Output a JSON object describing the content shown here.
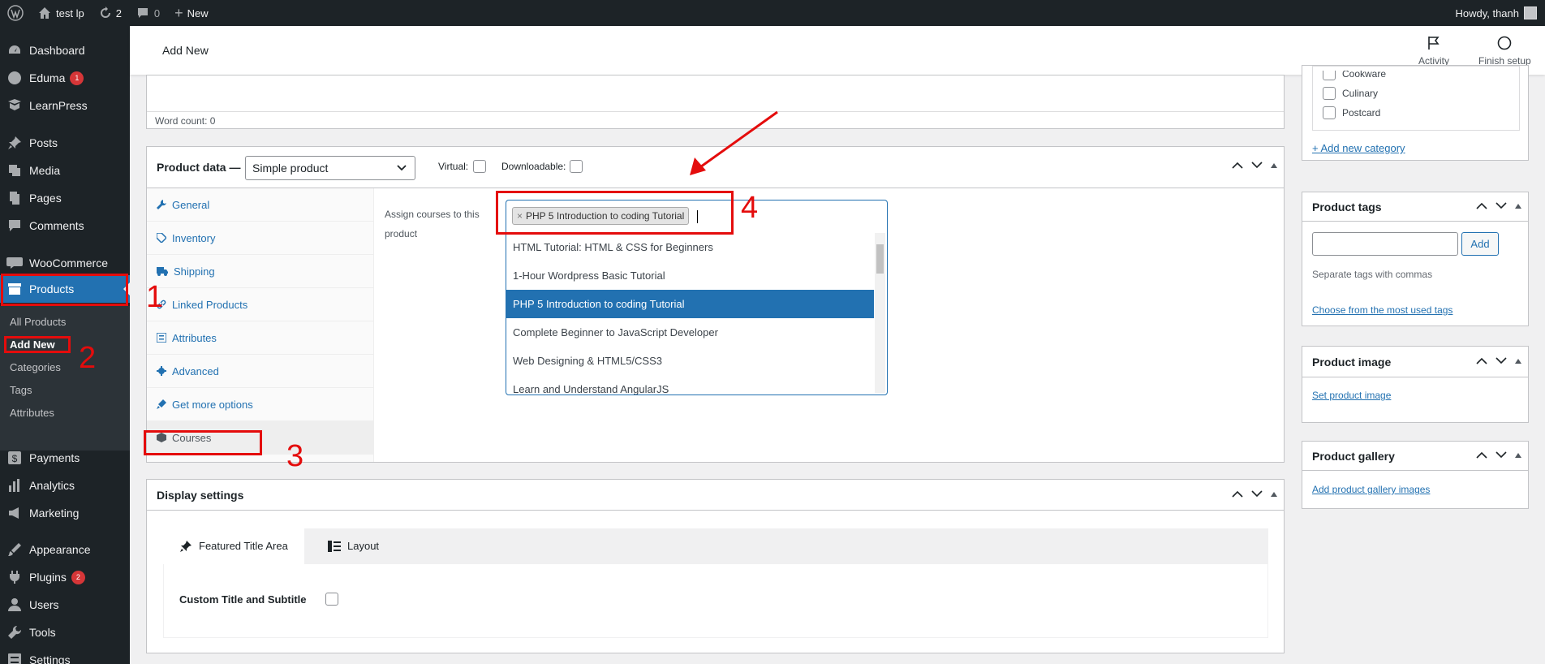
{
  "adminbar": {
    "site_name": "test lp",
    "updates_count": "2",
    "comments_count": "0",
    "new_label": "New",
    "howdy": "Howdy, thanh"
  },
  "sidebar": {
    "items": [
      {
        "label": "Dashboard",
        "icon": "dashboard-icon"
      },
      {
        "label": "Eduma",
        "icon": "eduma-icon",
        "badge": "1"
      },
      {
        "label": "LearnPress",
        "icon": "learnpress-icon"
      },
      {
        "label": "Posts",
        "icon": "pin-icon"
      },
      {
        "label": "Media",
        "icon": "media-icon"
      },
      {
        "label": "Pages",
        "icon": "pages-icon"
      },
      {
        "label": "Comments",
        "icon": "comments-icon"
      },
      {
        "label": "WooCommerce",
        "icon": "woocommerce-icon"
      },
      {
        "label": "Products",
        "icon": "archive-icon"
      },
      {
        "label": "Payments",
        "icon": "dollar-icon"
      },
      {
        "label": "Analytics",
        "icon": "bar-chart-icon"
      },
      {
        "label": "Marketing",
        "icon": "megaphone-icon"
      },
      {
        "label": "Appearance",
        "icon": "brush-icon"
      },
      {
        "label": "Plugins",
        "icon": "plug-icon",
        "badge": "2"
      },
      {
        "label": "Users",
        "icon": "user-icon"
      },
      {
        "label": "Tools",
        "icon": "wrench-icon"
      },
      {
        "label": "Settings",
        "icon": "settings-icon"
      }
    ],
    "submenu": [
      "All Products",
      "Add New",
      "Categories",
      "Tags",
      "Attributes"
    ]
  },
  "header": {
    "title": "Add New",
    "activity": "Activity",
    "finish_setup": "Finish setup"
  },
  "editor": {
    "word_count": "Word count: 0"
  },
  "product_data": {
    "title": "Product data —",
    "type_selected": "Simple product",
    "virtual_label": "Virtual:",
    "downloadable_label": "Downloadable:",
    "tabs": [
      "General",
      "Inventory",
      "Shipping",
      "Linked Products",
      "Attributes",
      "Advanced",
      "Get more options",
      "Courses"
    ],
    "assign_label": "Assign courses to this product",
    "selected_chip": "PHP 5 Introduction to coding Tutorial",
    "chip_remove": "×",
    "options": [
      "HTML Tutorial: HTML & CSS for Beginners",
      "1-Hour Wordpress Basic Tutorial",
      "PHP 5 Introduction to coding Tutorial",
      "Complete Beginner to JavaScript Developer",
      "Web Designing & HTML5/CSS3",
      "Learn and Understand AngularJS"
    ]
  },
  "display_settings": {
    "title": "Display settings",
    "tab_featured": "Featured Title Area",
    "tab_layout": "Layout",
    "custom_title_label": "Custom Title and Subtitle"
  },
  "categories": {
    "items": [
      "Cookware",
      "Culinary",
      "Postcard"
    ],
    "add_link": "+ Add new category"
  },
  "tags": {
    "title": "Product tags",
    "add_button": "Add",
    "hint": "Separate tags with commas",
    "most_used_link": "Choose from the most used tags"
  },
  "product_image": {
    "title": "Product image",
    "set_link": "Set product image"
  },
  "gallery": {
    "title": "Product gallery",
    "add_link": "Add product gallery images"
  },
  "annotations": [
    "1",
    "2",
    "3",
    "4"
  ],
  "colors": {
    "accent": "#2271b1",
    "annotation": "#e40c0c",
    "sidebar": "#1d2327"
  }
}
